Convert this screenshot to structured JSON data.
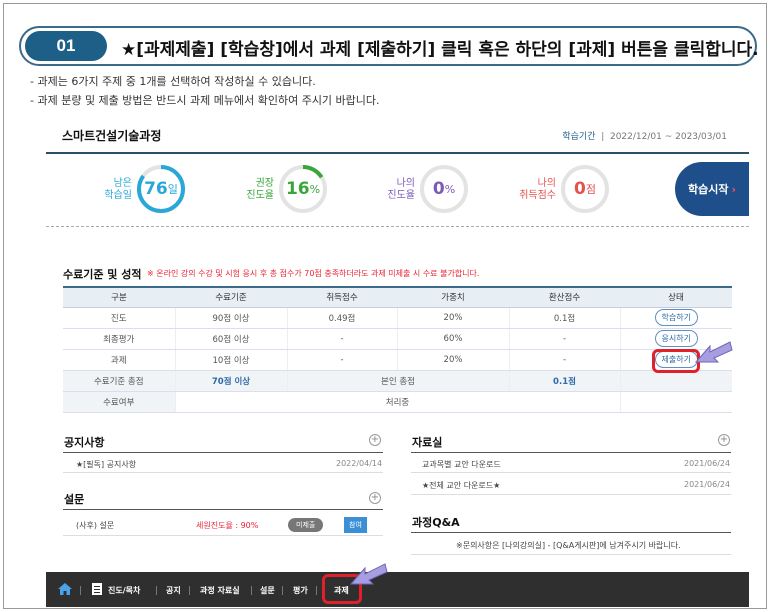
{
  "step": {
    "number": "01",
    "title": "★[과제제출] [학습창]에서 과제 [제출하기] 클릭 혹은 하단의 [과제] 버튼을 클릭합니다."
  },
  "notes": [
    "- 과제는 6가지 주제 중 1개를 선택하여 작성하실 수 있습니다.",
    "- 과제 분량 및 제출 방법은 반드시 과제 메뉴에서 확인하여 주시기 바랍니다."
  ],
  "course": {
    "title": "스마트건설기술과정",
    "period_label": "학습기간",
    "period_value": "2022/12/01 ~ 2023/03/01"
  },
  "stats": [
    {
      "label1": "남은",
      "label2": "학습일",
      "value": "76",
      "unit": "일",
      "color": "#29a8d8",
      "fraction": 0.85
    },
    {
      "label1": "권장",
      "label2": "진도율",
      "value": "16",
      "unit": "%",
      "color": "#3aa53a",
      "fraction": 0.16
    },
    {
      "label1": "나의",
      "label2": "진도율",
      "value": "0",
      "unit": "%",
      "color": "#7b5ab8",
      "fraction": 0
    },
    {
      "label1": "나의",
      "label2": "취득점수",
      "value": "0",
      "unit": "점",
      "color": "#e3534c",
      "fraction": 0
    }
  ],
  "start_button": {
    "label": "학습시작",
    "arrow": "›"
  },
  "requirements": {
    "title": "수료기준 및 성적",
    "warning": "※ 온라인 강의 수강 및 시험 응시 후 총 점수가 70점 충족하더라도 과제 미제출 시 수료 불가합니다.",
    "headers": [
      "구분",
      "수료기준",
      "취득점수",
      "가중치",
      "환산점수",
      "상태"
    ],
    "rows": [
      {
        "c1": "진도",
        "c2": "90점 이상",
        "c3": "0.49점",
        "c4": "20%",
        "c5": "0.1점",
        "btn": "학습하기"
      },
      {
        "c1": "최종평가",
        "c2": "60점 이상",
        "c3": "-",
        "c4": "60%",
        "c5": "-",
        "btn": "응시하기"
      },
      {
        "c1": "과제",
        "c2": "10점 이상",
        "c3": "-",
        "c4": "20%",
        "c5": "-",
        "btn": "제출하기"
      }
    ],
    "total": {
      "label": "수료기준 총점",
      "value": "70점 이상",
      "my_label": "본인 총점",
      "my_value": "0.1점"
    },
    "status": {
      "label": "수료여부",
      "value": "처리중"
    }
  },
  "notice": {
    "title": "공지사항",
    "items": [
      {
        "text": "★[필독] 공지사항",
        "date": "2022/04/14"
      }
    ]
  },
  "resources": {
    "title": "자료실",
    "items": [
      {
        "text": "교과목별 교안 다운로드",
        "date": "2021/06/24"
      },
      {
        "text": "★전체 교안 다운로드★",
        "date": "2021/06/24"
      }
    ]
  },
  "survey": {
    "title": "설문",
    "item": "(사후) 설문",
    "progress": "세원진도율 : 90%",
    "status": "미제출",
    "action": "참여"
  },
  "qa": {
    "title": "과정Q&A",
    "text": "※문의사항은 [나의강의실] - [Q&A게시판]에 남겨주시기 바랍니다."
  },
  "bottom_nav": {
    "items": [
      "진도/목차",
      "공지",
      "과정 자료실",
      "설문",
      "평가",
      "과제"
    ]
  }
}
